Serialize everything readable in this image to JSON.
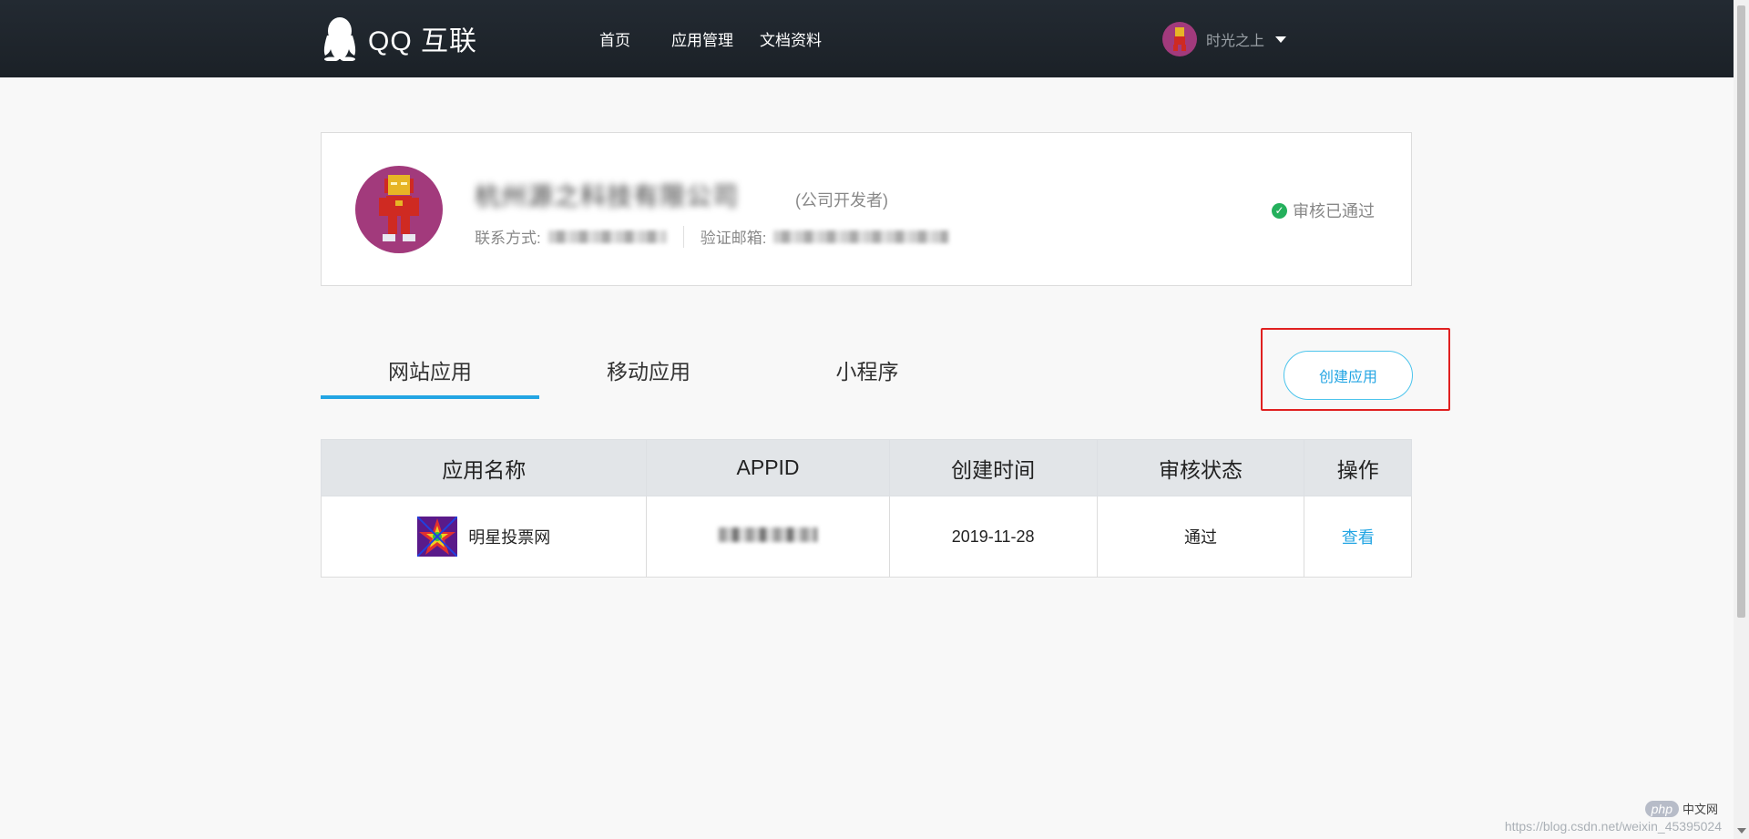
{
  "header": {
    "logo_text": "QQ 互联",
    "nav": [
      "首页",
      "应用管理",
      "文档资料"
    ],
    "user_name": "时光之上"
  },
  "profile": {
    "company_name": "杭州源之科技有限公司",
    "developer_type": "(公司开发者)",
    "contact_label": "联系方式:",
    "email_label": "验证邮箱:",
    "review_status": "审核已通过"
  },
  "tabs": {
    "items": [
      "网站应用",
      "移动应用",
      "小程序"
    ],
    "active": "网站应用"
  },
  "create_button": "创建应用",
  "table": {
    "headers": [
      "应用名称",
      "APPID",
      "创建时间",
      "审核状态",
      "操作"
    ],
    "rows": [
      {
        "name": "明星投票网",
        "created": "2019-11-28",
        "status": "通过",
        "action": "查看"
      }
    ]
  },
  "watermark": {
    "badge_pill": "php",
    "badge_text": "中文网",
    "url": "https://blog.csdn.net/weixin_45395024"
  },
  "colors": {
    "accent": "#23a5e3",
    "success": "#24b05c",
    "navbar": "#1f252c",
    "highlight": "#e02020"
  },
  "icons": [
    "qq-penguin-icon",
    "chevron-down-icon",
    "check-circle-icon",
    "app-star-icon"
  ]
}
